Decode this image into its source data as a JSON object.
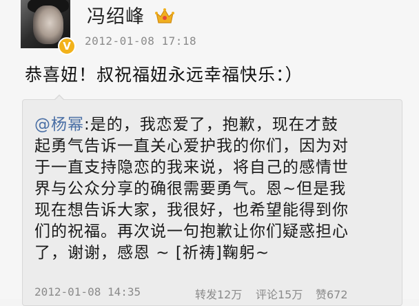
{
  "post": {
    "username": "冯绍峰",
    "timestamp": "2012-01-08 17:18",
    "text": "恭喜妞！叔祝福妞永远幸福快乐：）",
    "verified_badge": "V",
    "crown_icon": "crown-icon",
    "badge_color": "#f2b21b"
  },
  "repost": {
    "mention": "@杨幂",
    "lines": [
      ":是的，我恋爱了，抱歉，现在才鼓",
      "起勇气告诉一直关心爱护我的你们，因为对",
      "于一直支持隐恋的我来说，将自己的感情世",
      "界与公众分享的确很需要勇气。恩~但是我",
      "现在想告诉大家，我很好，也希望能得到你",
      "们的祝福。再次说一句抱歉让你们疑惑担心",
      "了，谢谢，感恩 ~ [祈祷]鞠躬~"
    ],
    "footer": {
      "time": "2012-01-08 14:35",
      "forward": "转发12万",
      "comment": "评论15万",
      "like": "赞672"
    }
  }
}
